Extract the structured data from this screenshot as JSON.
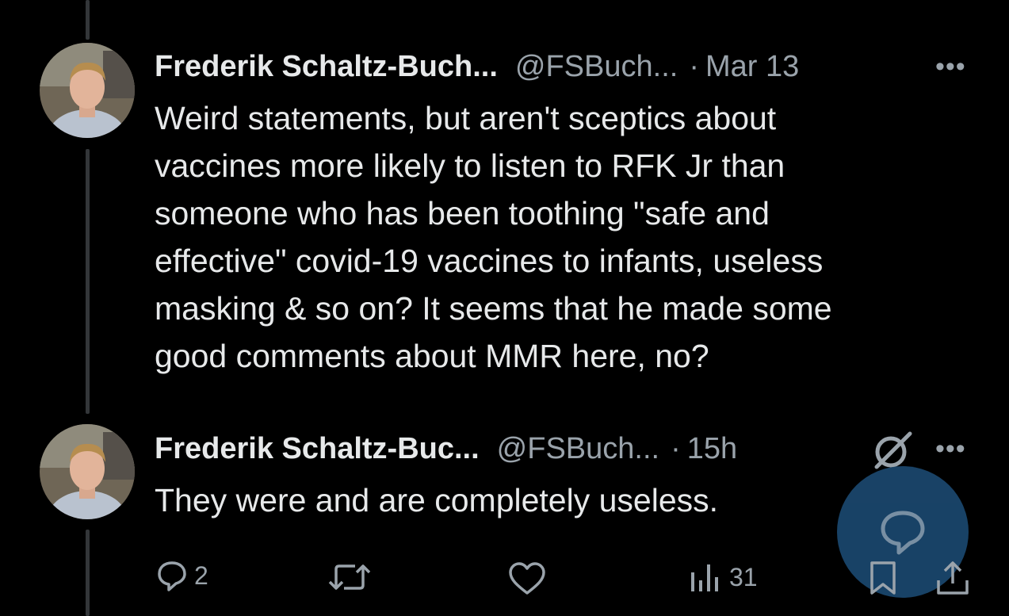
{
  "tweets": [
    {
      "author_name": "Frederik Schaltz-Buch...",
      "handle": "@FSBuch...",
      "separator": "·",
      "time": "Mar 13",
      "more": "•••",
      "text": "Weird statements, but aren't sceptics about\nvaccines more likely to listen to RFK Jr than\nsomeone who has been toothing \"safe and\neffective\" covid-19 vaccines to infants, useless\nmasking & so on? It seems that he made some\ngood comments about MMR here, no?"
    },
    {
      "author_name": "Frederik Schaltz-Buc...",
      "handle": "@FSBuch...",
      "separator": "·",
      "time": "15h",
      "more": "•••",
      "text": "They were and are completely useless.",
      "actions": {
        "reply_count": "2",
        "retweet_count": "",
        "like_count": "",
        "views_count": "31"
      }
    }
  ],
  "icons": {
    "reply": "speech-bubble-icon",
    "retweet": "retweet-arrows-icon",
    "like": "heart-icon",
    "views": "bar-chart-icon",
    "bookmark": "bookmark-icon",
    "share": "share-upload-icon",
    "grok": "grok-slash-circle-icon",
    "compose": "reply-compose-icon"
  },
  "colors": {
    "background": "#000000",
    "text": "#e7e9ea",
    "secondary": "#9aa3ab",
    "thread_line": "#333639",
    "fab": "#1d4e78"
  }
}
